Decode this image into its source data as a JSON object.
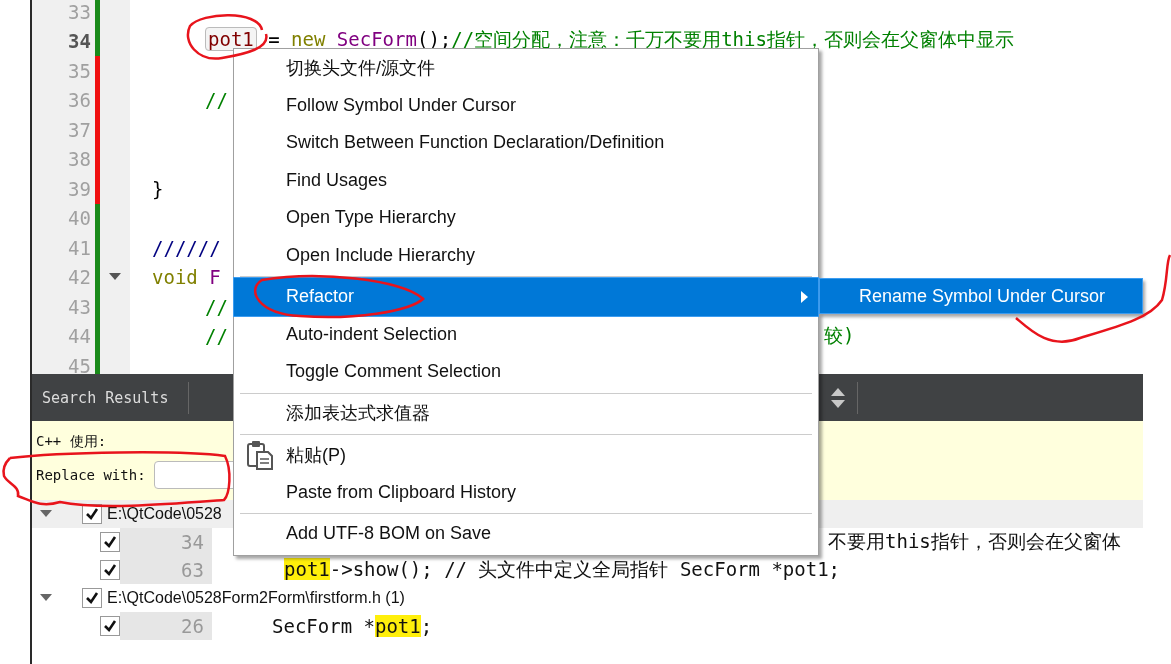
{
  "editor": {
    "lines": [
      {
        "number": "33",
        "current": false,
        "removed": false,
        "fold": false
      },
      {
        "number": "34",
        "current": true,
        "removed": false,
        "fold": false,
        "indented": true,
        "tokens": [
          {
            "kind": "cursor_symbol",
            "text": "pot1"
          },
          {
            "kind": "plain",
            "text": " = "
          },
          {
            "kind": "keyword",
            "text": "new "
          },
          {
            "kind": "type",
            "text": "SecForm"
          },
          {
            "kind": "plain",
            "text": "();"
          },
          {
            "kind": "comment",
            "text": "//空间分配，注意：千万不要用this指针，否则会在父窗体中显示"
          }
        ]
      },
      {
        "number": "35",
        "current": false,
        "removed": true,
        "fold": false
      },
      {
        "number": "36",
        "current": false,
        "removed": true,
        "fold": false,
        "indented": true,
        "tokens": [
          {
            "kind": "comment",
            "text": "//"
          }
        ]
      },
      {
        "number": "37",
        "current": false,
        "removed": true,
        "fold": false
      },
      {
        "number": "38",
        "current": false,
        "removed": true,
        "fold": false
      },
      {
        "number": "39",
        "current": false,
        "removed": true,
        "fold": false,
        "indented": false,
        "tokens": [
          {
            "kind": "plain",
            "text": "}"
          }
        ]
      },
      {
        "number": "40",
        "current": false,
        "removed": false,
        "fold": false
      },
      {
        "number": "41",
        "current": false,
        "removed": false,
        "fold": false,
        "indented": false,
        "tokens": [
          {
            "kind": "doc",
            "text": "//////"
          }
        ]
      },
      {
        "number": "42",
        "current": false,
        "removed": false,
        "fold": true,
        "indented": false,
        "tokens": [
          {
            "kind": "keyword",
            "text": "void "
          },
          {
            "kind": "type",
            "text": "F"
          }
        ]
      },
      {
        "number": "43",
        "current": false,
        "removed": false,
        "fold": false,
        "indented": true,
        "tokens": [
          {
            "kind": "comment",
            "text": "//"
          }
        ]
      },
      {
        "number": "44",
        "current": false,
        "removed": false,
        "fold": false,
        "indented": true,
        "tokens": [
          {
            "kind": "comment",
            "text": "//"
          }
        ],
        "tail": "较)"
      },
      {
        "number": "45",
        "current": false,
        "removed": false,
        "fold": false
      }
    ]
  },
  "search_panel": {
    "title": "Search Results",
    "scope_label": "C++ 使用:",
    "replace_label": "Replace with:",
    "results": [
      {
        "path": "E:\\QtCode\\0528",
        "checked": true,
        "expanded": true,
        "selected": true,
        "children": [
          {
            "line": "34",
            "checked": true,
            "indented": true,
            "hidden_start": true,
            "segments": [
              {
                "text": "不要用this指针，否则会在父窗体",
                "highlight": false
              }
            ]
          },
          {
            "line": "63",
            "checked": true,
            "indented": true,
            "hidden_start": false,
            "segments": [
              {
                "text": "pot1",
                "highlight": true
              },
              {
                "text": "->show(); // 头文件中定义全局指针 SecForm *pot1;",
                "highlight": false
              }
            ]
          }
        ]
      },
      {
        "path": "E:\\QtCode\\0528Form2Form\\firstform.h (1)",
        "checked": true,
        "expanded": true,
        "selected": false,
        "children": [
          {
            "line": "26",
            "checked": true,
            "indented": false,
            "hidden_start": false,
            "segments": [
              {
                "text": "SecForm *",
                "highlight": false
              },
              {
                "text": "pot1",
                "highlight": true
              },
              {
                "text": ";",
                "highlight": false
              }
            ]
          }
        ]
      }
    ]
  },
  "context_menu": {
    "items": [
      {
        "kind": "item",
        "label": "切换头文件/源文件",
        "selected": false
      },
      {
        "kind": "item",
        "label": "Follow Symbol Under Cursor",
        "selected": false
      },
      {
        "kind": "item",
        "label": "Switch Between Function Declaration/Definition",
        "selected": false
      },
      {
        "kind": "item",
        "label": "Find Usages",
        "selected": false
      },
      {
        "kind": "item",
        "label": "Open Type Hierarchy",
        "selected": false
      },
      {
        "kind": "item",
        "label": "Open Include Hierarchy",
        "selected": false
      },
      {
        "kind": "separator"
      },
      {
        "kind": "submenu",
        "label": "Refactor",
        "selected": true
      },
      {
        "kind": "item",
        "label": "Auto-indent Selection",
        "selected": false
      },
      {
        "kind": "item",
        "label": "Toggle Comment Selection",
        "selected": false
      },
      {
        "kind": "separator"
      },
      {
        "kind": "item",
        "label": "添加表达式求值器",
        "selected": false
      },
      {
        "kind": "separator"
      },
      {
        "kind": "paste",
        "label": "粘贴(P)",
        "selected": false
      },
      {
        "kind": "item",
        "label": "Paste from Clipboard History",
        "selected": false
      },
      {
        "kind": "separator"
      },
      {
        "kind": "item",
        "label": "Add UTF-8 BOM on Save",
        "selected": false
      }
    ]
  },
  "submenu": {
    "items": [
      {
        "label": "Rename Symbol Under Cursor",
        "selected": true
      }
    ]
  }
}
